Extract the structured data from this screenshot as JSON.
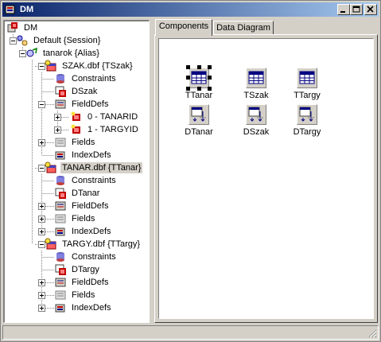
{
  "window": {
    "title": "DM"
  },
  "colors": {
    "titlebar_start": "#0a246a",
    "titlebar_end": "#a6caf0",
    "face": "#d4d0c8"
  },
  "tree": [
    {
      "label": "DM",
      "icon": "datamodule-icon"
    },
    {
      "label": "Default {Session}",
      "icon": "session-icon"
    },
    {
      "label": "tanarok {Alias}",
      "icon": "alias-icon"
    },
    {
      "label": "SZAK.dbf {TSzak}",
      "icon": "table-icon"
    },
    {
      "label": "Constraints",
      "icon": "constraints-icon"
    },
    {
      "label": "DSzak",
      "icon": "datasource-icon"
    },
    {
      "label": "FieldDefs",
      "icon": "fielddefs-icon"
    },
    {
      "label": "0 - TANARID",
      "icon": "field-icon"
    },
    {
      "label": "1 - TARGYID",
      "icon": "field-icon"
    },
    {
      "label": "Fields",
      "icon": "fields-icon"
    },
    {
      "label": "IndexDefs",
      "icon": "indexdefs-icon"
    },
    {
      "label": "TANAR.dbf {TTanar}",
      "icon": "table-icon"
    },
    {
      "label": "Constraints",
      "icon": "constraints-icon"
    },
    {
      "label": "DTanar",
      "icon": "datasource-icon"
    },
    {
      "label": "FieldDefs",
      "icon": "fielddefs-icon"
    },
    {
      "label": "Fields",
      "icon": "fields-icon"
    },
    {
      "label": "IndexDefs",
      "icon": "indexdefs-icon"
    },
    {
      "label": "TARGY.dbf {TTargy}",
      "icon": "table-icon"
    },
    {
      "label": "Constraints",
      "icon": "constraints-icon"
    },
    {
      "label": "DTargy",
      "icon": "datasource-icon"
    },
    {
      "label": "FieldDefs",
      "icon": "fielddefs-icon"
    },
    {
      "label": "Fields",
      "icon": "fields-icon"
    },
    {
      "label": "IndexDefs",
      "icon": "indexdefs-icon"
    }
  ],
  "tabs": [
    {
      "label": "Components",
      "active": true
    },
    {
      "label": "Data Diagram",
      "active": false
    }
  ],
  "components": [
    {
      "label": "TTanar",
      "icon": "table-component-icon",
      "selected": true
    },
    {
      "label": "TSzak",
      "icon": "table-component-icon",
      "selected": false
    },
    {
      "label": "TTargy",
      "icon": "table-component-icon",
      "selected": false
    },
    {
      "label": "DTanar",
      "icon": "datasource-component-icon",
      "selected": false
    },
    {
      "label": "DSzak",
      "icon": "datasource-component-icon",
      "selected": false
    },
    {
      "label": "DTargy",
      "icon": "datasource-component-icon",
      "selected": false
    }
  ]
}
